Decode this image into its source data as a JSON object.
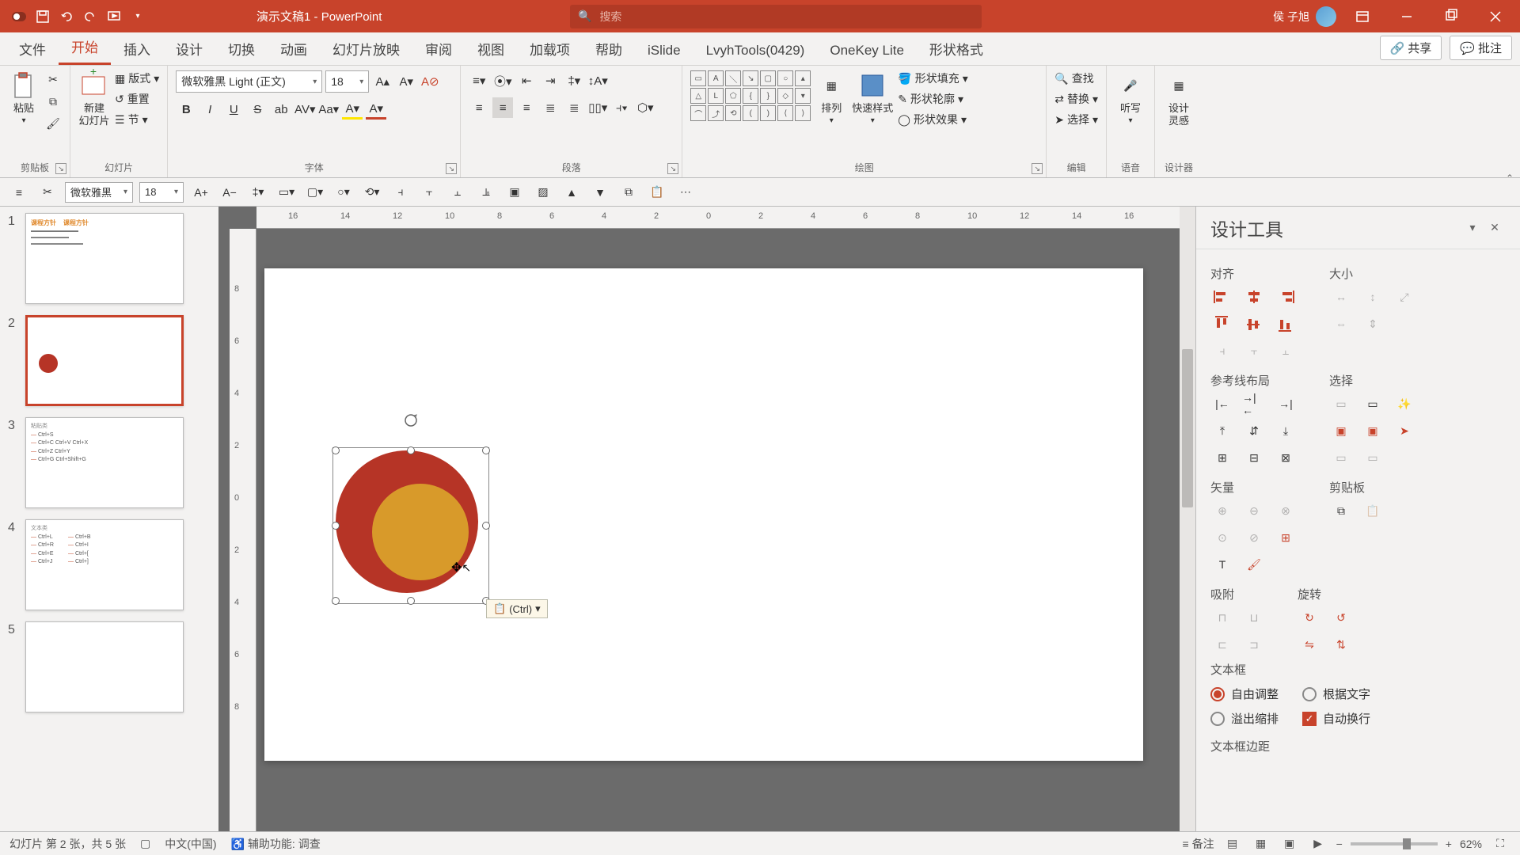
{
  "title": {
    "app": "PowerPoint",
    "doc": "演示文稿1",
    "sep": " - "
  },
  "search": {
    "placeholder": "搜索"
  },
  "user": {
    "name": "侯 子旭"
  },
  "tabs": {
    "items": [
      "文件",
      "开始",
      "插入",
      "设计",
      "切换",
      "动画",
      "幻灯片放映",
      "审阅",
      "视图",
      "加载项",
      "帮助",
      "iSlide",
      "LvyhTools(0429)",
      "OneKey Lite",
      "形状格式"
    ],
    "active_index": 1,
    "share": "共享",
    "comment": "批注"
  },
  "ribbon": {
    "clipboard": {
      "paste": "粘贴",
      "label": "剪贴板"
    },
    "slides": {
      "new": "新建\n幻灯片",
      "layout": "版式",
      "reset": "重置",
      "section": "节",
      "label": "幻灯片"
    },
    "font": {
      "name": "微软雅黑 Light (正文)",
      "size": "18",
      "label": "字体"
    },
    "paragraph": {
      "label": "段落"
    },
    "drawing": {
      "arrange": "排列",
      "quick": "快速样式",
      "fill": "形状填充",
      "outline": "形状轮廓",
      "effects": "形状效果",
      "label": "绘图"
    },
    "editing": {
      "find": "查找",
      "replace": "替换",
      "select": "选择",
      "label": "编辑"
    },
    "voice": {
      "dictate": "听写",
      "label": "语音"
    },
    "designer": {
      "ideas": "设计\n灵感",
      "label": "设计器"
    }
  },
  "sec_toolbar": {
    "font": "微软雅黑",
    "size": "18"
  },
  "ruler_h": [
    "16",
    "14",
    "12",
    "10",
    "8",
    "6",
    "4",
    "2",
    "0",
    "2",
    "4",
    "6",
    "8",
    "10",
    "12",
    "14",
    "16"
  ],
  "ruler_v": [
    "8",
    "6",
    "4",
    "2",
    "0",
    "2",
    "4",
    "6",
    "8"
  ],
  "thumbs": [
    {
      "n": "1",
      "type": "title"
    },
    {
      "n": "2",
      "type": "circle",
      "selected": true
    },
    {
      "n": "3",
      "type": "shortcuts1",
      "lines": [
        "Ctrl+S",
        "Ctrl+C  Ctrl+V  Ctrl+X",
        "Ctrl+Z  Ctrl+Y",
        "Ctrl+G  Ctrl+Shift+G"
      ],
      "header": "粘贴类"
    },
    {
      "n": "4",
      "type": "shortcuts2",
      "header": "文本类",
      "col1": [
        "Ctrl+L",
        "Ctrl+R",
        "Ctrl+E",
        "Ctrl+J"
      ],
      "col2": [
        "Ctrl+B",
        "Ctrl+I",
        "Ctrl+[",
        "Ctrl+]"
      ]
    },
    {
      "n": "5",
      "type": "blank"
    }
  ],
  "paste_tag": "(Ctrl)",
  "design_pane": {
    "title": "设计工具",
    "align": "对齐",
    "size": "大小",
    "guides": "参考线布局",
    "select": "选择",
    "vector": "矢量",
    "clipboard": "剪贴板",
    "snap": "吸附",
    "rotate": "旋转",
    "textbox": "文本框",
    "tb_free": "自由调整",
    "tb_by_text": "根据文字",
    "tb_overflow": "溢出缩排",
    "tb_wrap": "自动换行",
    "tb_margin": "文本框边距"
  },
  "status": {
    "slide": "幻灯片 第 2 张，共 5 张",
    "lang": "中文(中国)",
    "access": "辅助功能: 调查",
    "notes": "备注",
    "zoom": "62%"
  }
}
